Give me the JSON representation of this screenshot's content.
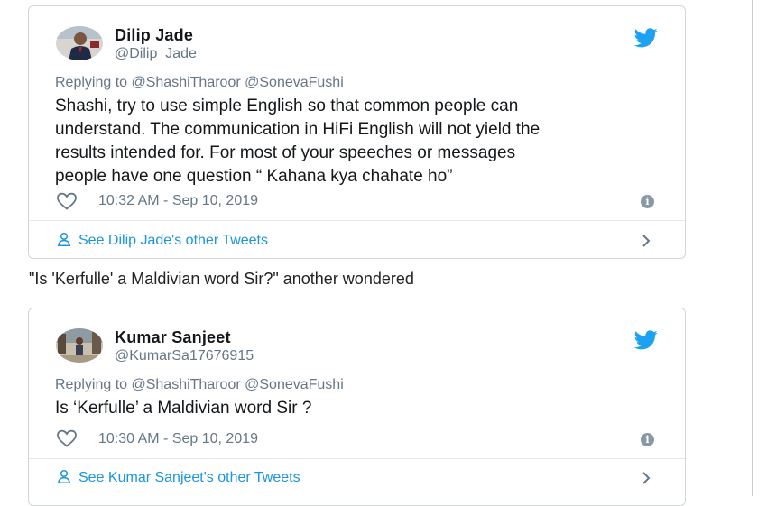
{
  "tweets": [
    {
      "name": "Dilip Jade",
      "handle": "@Dilip_Jade",
      "replying_to": "Replying to @ShashiTharoor @SonevaFushi",
      "text_lines": [
        "Shashi, try to use simple English so that common people can",
        "understand. The communication in HiFi English will not yield the",
        "results intended for. For most of your speeches or messages",
        "people have one question “ Kahana kya chahate ho”"
      ],
      "timestamp": "10:32 AM - Sep 10, 2019",
      "info_glyph": "i",
      "other_tweets_link": "See Dilip Jade's other Tweets"
    },
    {
      "name": "Kumar Sanjeet",
      "handle": "@KumarSa17676915",
      "replying_to": "Replying to @ShashiTharoor @SonevaFushi",
      "text_lines": [
        "Is ‘Kerfulle’ a Maldivian word Sir ?"
      ],
      "timestamp": "10:30 AM - Sep 10, 2019",
      "info_glyph": "i",
      "other_tweets_link": "See Kumar Sanjeet's other Tweets"
    }
  ],
  "caption": "\"Is 'Kerfulle' a Maldivian word Sir?\" another wondered",
  "icons": {
    "brand": "twitter-bird-icon",
    "like": "heart-icon",
    "info": "info-icon",
    "person": "person-icon",
    "chevron": "chevron-right-icon"
  },
  "colors": {
    "twitter_blue": "#1da1f2",
    "link_blue": "#1b95e0",
    "secondary_text": "#657786",
    "border": "#d2d6da"
  }
}
